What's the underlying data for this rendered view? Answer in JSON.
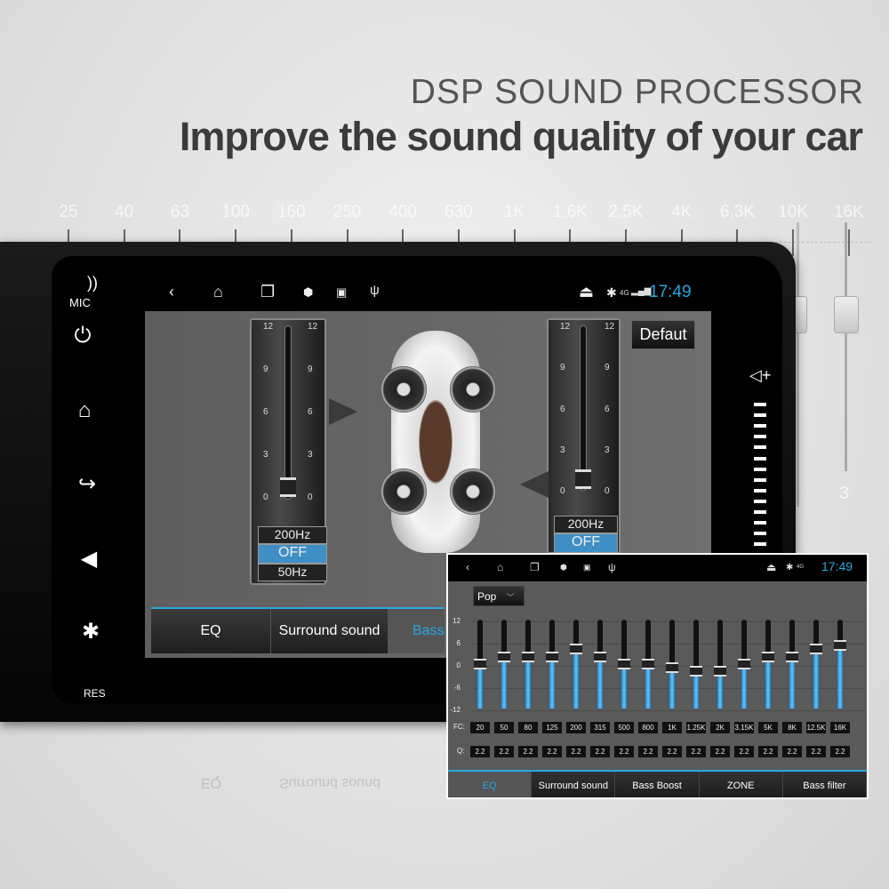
{
  "headline": {
    "title": "DSP SOUND PROCESSOR",
    "subtitle": "Improve the sound quality of your car"
  },
  "background_eq": {
    "labels": [
      "25",
      "40",
      "63",
      "100",
      "160",
      "250",
      "400",
      "630",
      "1K",
      "1.6K",
      "2.5K",
      "4K",
      "6.3K",
      "10K",
      "16K"
    ],
    "side_value": "3"
  },
  "head_unit": {
    "side_buttons": {
      "mic": "MIC",
      "res": "RES",
      "icons": [
        "power-icon",
        "home-icon",
        "back-icon",
        "navigation-icon",
        "bluetooth-icon"
      ]
    },
    "status_bar": {
      "time": "17:49",
      "network": "4G",
      "icons": [
        "back-icon",
        "home-icon",
        "recent-apps-icon",
        "shield-icon",
        "image-icon",
        "usb-icon",
        "eject-icon",
        "bluetooth-icon",
        "signal-icon"
      ]
    },
    "left_slider": {
      "ticks": [
        "12",
        "9",
        "6",
        "3",
        "0"
      ],
      "value": 0,
      "freq_options": [
        "200Hz",
        "OFF",
        "50Hz"
      ],
      "selected": "OFF"
    },
    "right_slider": {
      "ticks": [
        "12",
        "9",
        "6",
        "3",
        "0"
      ],
      "value": 0,
      "freq_options": [
        "200Hz",
        "OFF"
      ],
      "selected": "OFF"
    },
    "default_button": "Defaut",
    "tabs": [
      {
        "label": "EQ"
      },
      {
        "label": "Surround sound"
      },
      {
        "label": "Bass",
        "active": true
      }
    ],
    "volume_levels": 14,
    "accent": "#29a8e0"
  },
  "inset": {
    "time": "17:49",
    "network": "4G",
    "preset": "Pop",
    "y_labels": [
      "12",
      "6",
      "0",
      "-6",
      "-12"
    ],
    "fc_label": "FC:",
    "q_label": "Q:",
    "bands": [
      {
        "fc": "20",
        "q": "2.2",
        "gain": 0
      },
      {
        "fc": "50",
        "q": "2.2",
        "gain": 2
      },
      {
        "fc": "80",
        "q": "2.2",
        "gain": 2
      },
      {
        "fc": "125",
        "q": "2.2",
        "gain": 2
      },
      {
        "fc": "200",
        "q": "2.2",
        "gain": 4
      },
      {
        "fc": "315",
        "q": "2.2",
        "gain": 2
      },
      {
        "fc": "500",
        "q": "2.2",
        "gain": 0
      },
      {
        "fc": "800",
        "q": "2.2",
        "gain": 0
      },
      {
        "fc": "1K",
        "q": "2.2",
        "gain": -1
      },
      {
        "fc": "1.25K",
        "q": "2.2",
        "gain": -2
      },
      {
        "fc": "2K",
        "q": "2.2",
        "gain": -2
      },
      {
        "fc": "3.15K",
        "q": "2.2",
        "gain": 0
      },
      {
        "fc": "5K",
        "q": "2.2",
        "gain": 2
      },
      {
        "fc": "8K",
        "q": "2.2",
        "gain": 2
      },
      {
        "fc": "12.5K",
        "q": "2.2",
        "gain": 4
      },
      {
        "fc": "16K",
        "q": "2.2",
        "gain": 5
      }
    ],
    "tabs": [
      {
        "label": "EQ",
        "active": true
      },
      {
        "label": "Surround sound"
      },
      {
        "label": "Bass Boost"
      },
      {
        "label": "ZONE"
      },
      {
        "label": "Bass filter"
      }
    ]
  }
}
